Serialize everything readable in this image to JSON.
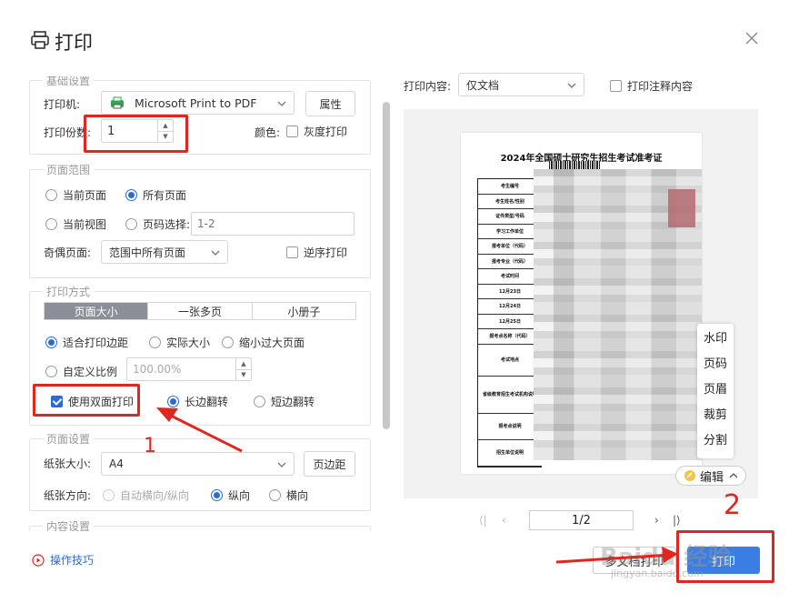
{
  "dialog": {
    "title": "打印"
  },
  "basic": {
    "legend": "基础设置",
    "printer_label": "打印机:",
    "printer_value": "Microsoft Print to PDF",
    "properties_button": "属性",
    "copies_label": "打印份数:",
    "copies_value": "1",
    "color_label": "颜色:",
    "grayscale_label": "灰度打印"
  },
  "range": {
    "legend": "页面范围",
    "current_page": "当前页面",
    "all_pages": "所有页面",
    "current_view": "当前视图",
    "page_select": "页码选择:",
    "page_select_placeholder": "1-2",
    "odd_even_label": "奇偶页面:",
    "odd_even_value": "范围中所有页面",
    "reverse_label": "逆序打印"
  },
  "method": {
    "legend": "打印方式",
    "tabs": [
      "页面大小",
      "一张多页",
      "小册子"
    ],
    "fit_margin": "适合打印边距",
    "actual_size": "实际大小",
    "shrink_large": "缩小过大页面",
    "custom_scale": "自定义比例",
    "custom_scale_value": "100.00%",
    "duplex_label": "使用双面打印",
    "long_edge": "长边翻转",
    "short_edge": "短边翻转"
  },
  "paper": {
    "legend": "页面设置",
    "size_label": "纸张大小:",
    "size_value": "A4",
    "margin_button": "页边距",
    "orientation_label": "纸张方向:",
    "auto_orient": "自动横向/纵向",
    "portrait": "纵向",
    "landscape": "横向"
  },
  "content": {
    "legend": "内容设置"
  },
  "tips": {
    "label": "操作技巧"
  },
  "preview": {
    "content_label": "打印内容:",
    "content_value": "仅文档",
    "annotation_label": "打印注释内容",
    "doc_title": "2024年全国硕士研究生招生考试准考证",
    "doc_rows": [
      "考生编号",
      "考生姓名/性别",
      "证件类型/号码",
      "学习工作单位",
      "报考单位（代码）",
      "报考专业（代码）",
      "考试时间",
      "12月23日",
      "12月24日",
      "12月25日",
      "报考点名称（代码）",
      "考试地点",
      "",
      "省级教育招生考试机构说明",
      "",
      "报考点说明",
      "",
      "招生单位说明"
    ],
    "side_menu": [
      "水印",
      "页码",
      "页眉",
      "裁剪",
      "分割"
    ],
    "edit_label": "编辑",
    "page_indicator": "1/2"
  },
  "footer": {
    "multi_doc_button": "多文档打印",
    "print_button": "打印"
  },
  "annotations": {
    "number_1": "1",
    "number_2": "2",
    "watermark": "Baidu 经验",
    "watermark_sub": "jingyan.baidu.com"
  }
}
